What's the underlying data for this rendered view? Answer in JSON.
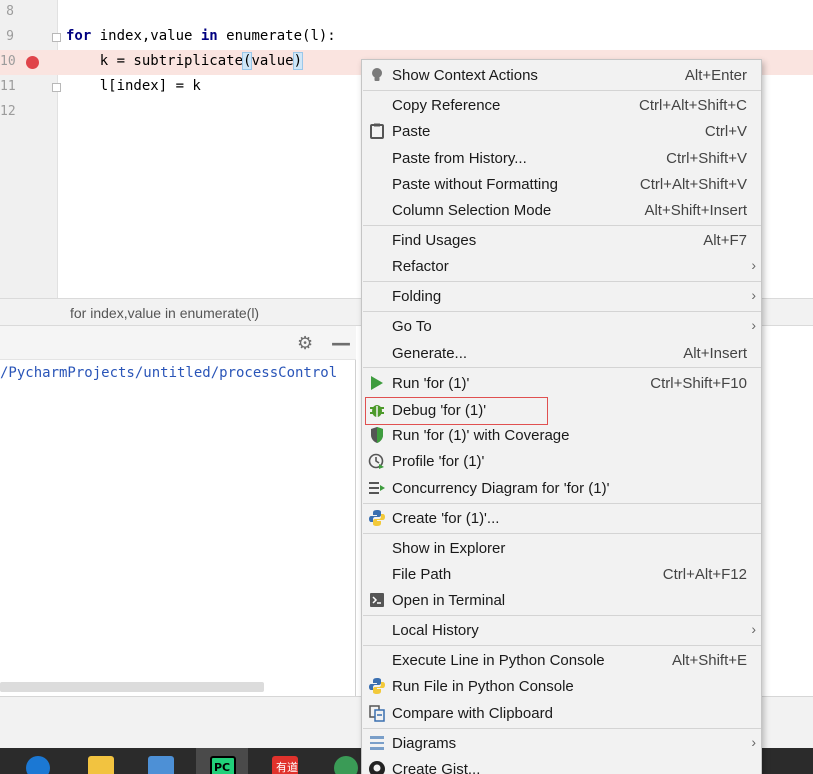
{
  "editor": {
    "lines": [
      {
        "num": "8",
        "code": ""
      },
      {
        "num": "9",
        "kw1": "for",
        "mid": " index,value ",
        "kw2": "in",
        "rest": " enumerate(l):"
      },
      {
        "num": "10",
        "pre": "    k = subtriplicate",
        "paren_open": "(",
        "arg": "value",
        "paren_close": ")"
      },
      {
        "num": "11",
        "code": "    l[index] = k"
      },
      {
        "num": "12",
        "code": ""
      }
    ],
    "breadcrumb": "for index,value in enumerate(l)"
  },
  "run_panel": {
    "path_text": "/PycharmProjects/untitled/processControl"
  },
  "taskbar": {
    "pc_label": "PC",
    "youdao_label": "有道"
  },
  "context_menu": {
    "items": [
      {
        "label": "Show Context Actions",
        "shortcut": "Alt+Enter",
        "icon": "lightbulb-icon"
      },
      {
        "label": "Copy Reference",
        "shortcut": "Ctrl+Alt+Shift+C"
      },
      {
        "label": "Paste",
        "shortcut": "Ctrl+V",
        "icon": "clipboard-icon"
      },
      {
        "label": "Paste from History...",
        "shortcut": "Ctrl+Shift+V"
      },
      {
        "label": "Paste without Formatting",
        "shortcut": "Ctrl+Alt+Shift+V"
      },
      {
        "label": "Column Selection Mode",
        "shortcut": "Alt+Shift+Insert"
      },
      {
        "label": "Find Usages",
        "shortcut": "Alt+F7"
      },
      {
        "label": "Refactor",
        "shortcut": ""
      },
      {
        "label": "Folding",
        "shortcut": ""
      },
      {
        "label": "Go To",
        "shortcut": ""
      },
      {
        "label": "Generate...",
        "shortcut": "Alt+Insert"
      },
      {
        "label": "Run 'for (1)'",
        "shortcut": "Ctrl+Shift+F10",
        "icon": "run-icon"
      },
      {
        "label": "Debug 'for (1)'",
        "shortcut": "",
        "icon": "debug-bug-icon"
      },
      {
        "label": "Run 'for (1)' with Coverage",
        "shortcut": "",
        "icon": "coverage-shield-icon"
      },
      {
        "label": "Profile 'for (1)'",
        "shortcut": "",
        "icon": "profile-clock-icon"
      },
      {
        "label": "Concurrency Diagram for 'for (1)'",
        "shortcut": "",
        "icon": "concurrency-icon"
      },
      {
        "label": "Create 'for (1)'...",
        "shortcut": "",
        "icon": "python-icon"
      },
      {
        "label": "Show in Explorer",
        "shortcut": ""
      },
      {
        "label": "File Path",
        "shortcut": "Ctrl+Alt+F12"
      },
      {
        "label": "Open in Terminal",
        "shortcut": "",
        "icon": "terminal-icon"
      },
      {
        "label": "Local History",
        "shortcut": ""
      },
      {
        "label": "Execute Line in Python Console",
        "shortcut": "Alt+Shift+E"
      },
      {
        "label": "Run File in Python Console",
        "shortcut": "",
        "icon": "python-icon"
      },
      {
        "label": "Compare with Clipboard",
        "shortcut": "",
        "icon": "compare-icon"
      },
      {
        "label": "Diagrams",
        "shortcut": "",
        "icon": "diagram-icon"
      },
      {
        "label": "Create Gist...",
        "shortcut": "",
        "icon": "github-icon"
      }
    ]
  }
}
